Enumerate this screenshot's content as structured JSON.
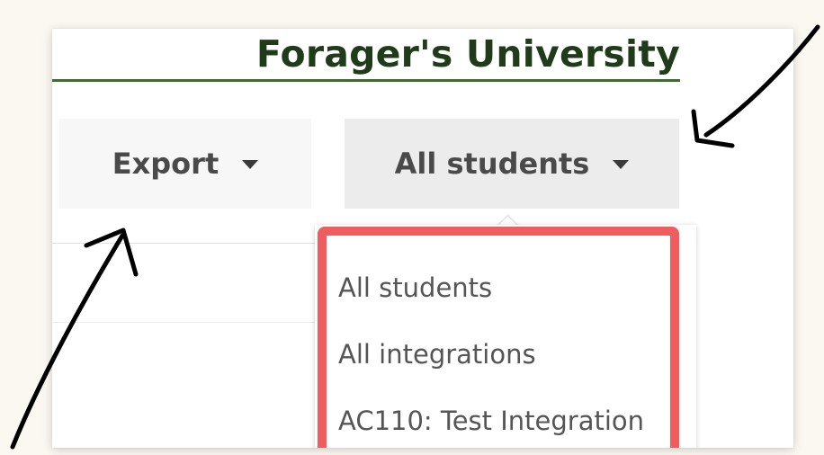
{
  "header": {
    "title": "Forager's University",
    "title_color": "#1f3b19",
    "rule_color": "#3f6b2c"
  },
  "toolbar": {
    "export_label": "Export",
    "filter_label": "All students"
  },
  "dropdown": {
    "items": [
      {
        "label": "All students"
      },
      {
        "label": "All integrations"
      },
      {
        "label": "AC110: Test Integration"
      }
    ]
  },
  "annotations": {
    "highlight_color": "#f05d5e",
    "arrow_color": "#000000",
    "icons": [
      "arrow-icon",
      "arrow-icon",
      "caret-down-icon"
    ]
  }
}
